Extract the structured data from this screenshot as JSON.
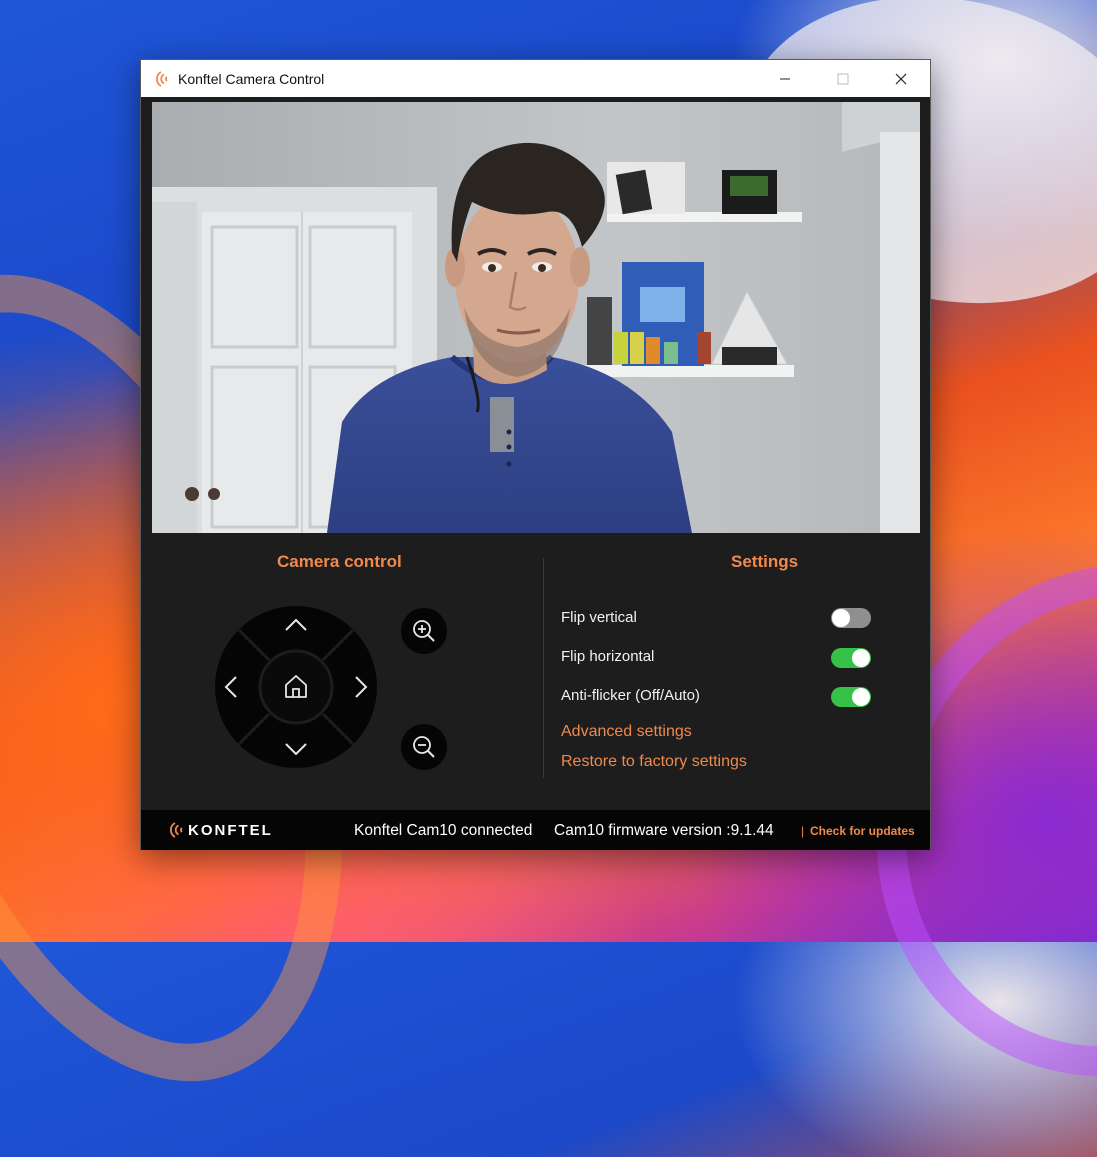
{
  "window": {
    "title": "Konftel Camera Control"
  },
  "camera_control": {
    "title": "Camera control"
  },
  "settings": {
    "title": "Settings",
    "items": [
      {
        "label": "Flip vertical",
        "enabled": false
      },
      {
        "label": "Flip horizontal",
        "enabled": true
      },
      {
        "label": "Anti-flicker (Off/Auto)",
        "enabled": true
      }
    ],
    "advanced_label": "Advanced settings",
    "restore_label": "Restore to factory settings"
  },
  "footer": {
    "brand": "KONFTEL",
    "status": "Konftel Cam10 connected",
    "firmware": "Cam10 firmware version :9.1.44",
    "separator": "|",
    "update_label": "Check for updates"
  },
  "colors": {
    "accent": "#f0894d",
    "toggle_on": "#36c248",
    "toggle_off": "#8f8f8f",
    "panel_bg": "#1d1d1d"
  }
}
